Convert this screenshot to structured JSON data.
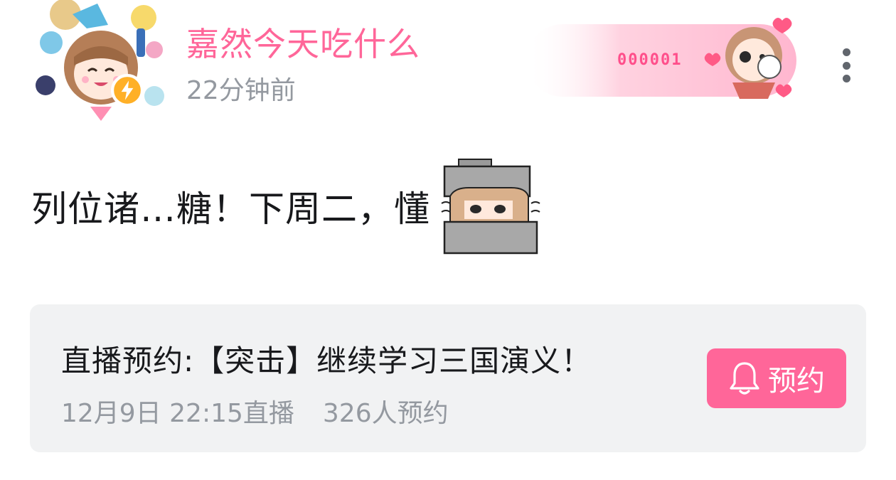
{
  "user": {
    "name": "嘉然今天吃什么",
    "time_ago": "22分钟前",
    "fan_badge_number": "000001"
  },
  "post": {
    "text": "列位诸…糖！下周二，懂"
  },
  "reservation": {
    "title": "直播预约:【突击】继续学习三国演义！",
    "date": "12月9日 22:15直播",
    "count": "326人预约",
    "button_label": "预约"
  },
  "colors": {
    "accent": "#ff6699",
    "muted": "#9499a0",
    "card_bg": "#f1f2f3"
  },
  "icons": {
    "more": "more-vertical-icon",
    "bell": "bell-icon",
    "verified": "lightning-icon"
  }
}
